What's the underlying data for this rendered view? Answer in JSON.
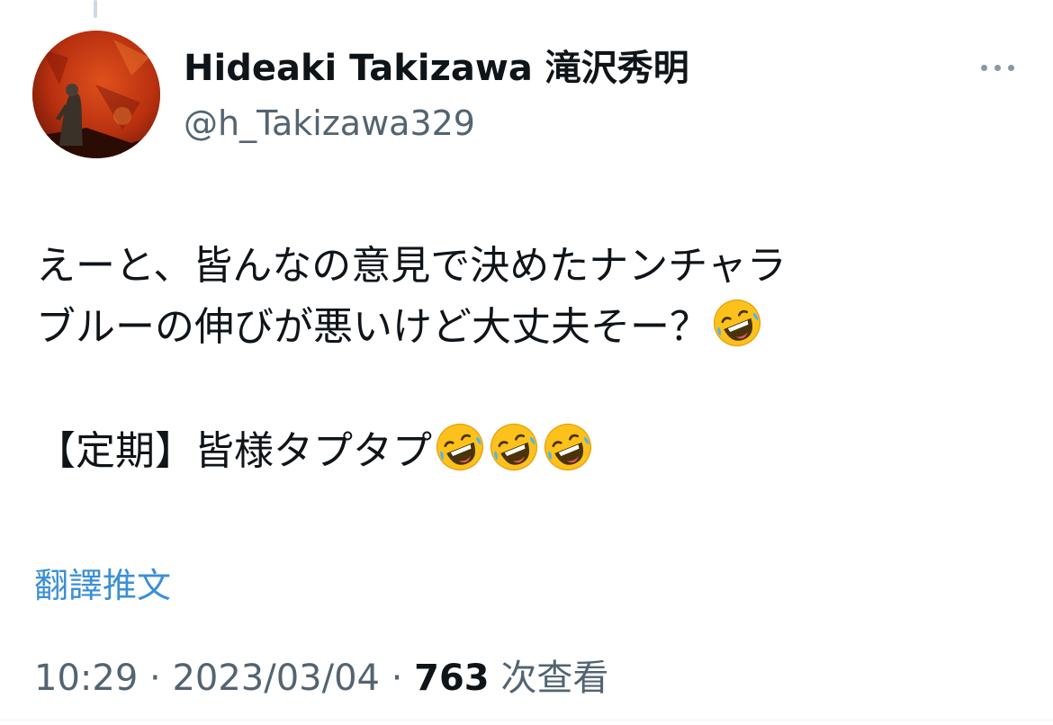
{
  "tweet": {
    "author": {
      "display_name": "Hideaki Takizawa 滝沢秀明",
      "handle": "@h_Takizawa329",
      "avatar_icon": "avatar-image"
    },
    "more_icon": "more-horizontal-icon",
    "lines": [
      "えーと、皆んなの意見で決めたナンチャラ",
      "ブルーの伸びが悪いけど大丈夫そー？",
      "【定期】皆様タプタプ"
    ],
    "emoji": {
      "name": "rolling-on-the-floor-laughing",
      "line2_count": 1,
      "line3_count": 3
    },
    "translate_label": "翻譯推文",
    "time": "10:29",
    "date": "2023/03/04",
    "separator": "·",
    "views_count": "763",
    "views_label": "次查看"
  },
  "colors": {
    "text_primary": "#0f1419",
    "text_secondary": "#536471",
    "link_blue": "#3b8fd6",
    "divider": "#eff3f4"
  }
}
